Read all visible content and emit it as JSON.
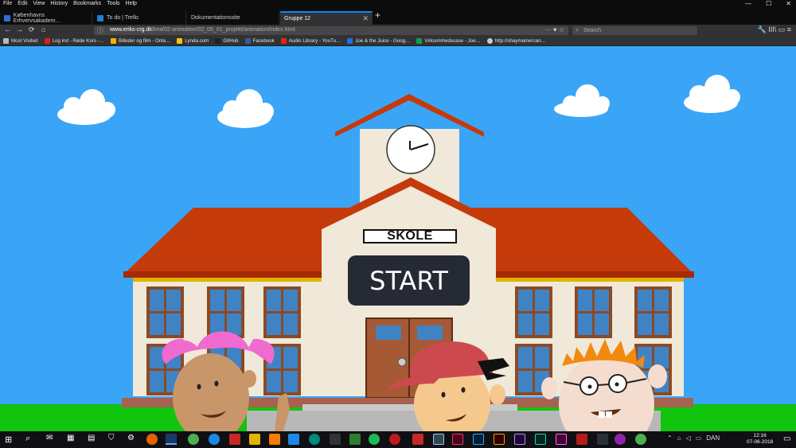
{
  "menubar": {
    "items": [
      "File",
      "Edit",
      "View",
      "History",
      "Bookmarks",
      "Tools",
      "Help"
    ],
    "minimize": "—",
    "maximize": "☐",
    "close": "✕"
  },
  "tabs": [
    {
      "label": "Københavns Erhvervsakadem…",
      "color": "#2b6fd6"
    },
    {
      "label": "To do | Trello",
      "color": "#1f7fd1"
    },
    {
      "label": "Dokumentationssite",
      "color": "#777777"
    },
    {
      "label": "Gruppe 12",
      "color": "#888888"
    }
  ],
  "new_tab": "+",
  "nav": {
    "back": "←",
    "forward": "→",
    "reload": "⟳",
    "home": "⌂",
    "url_host": "www.eriks-crg.dk",
    "url_path": "/kea/02-animation/02_05_01_projekt/animation/index.html",
    "url_actions": "··· ♥ ☆",
    "search_placeholder": "Search",
    "tools": "🔧  III\\  ▭  ≡"
  },
  "bookmarks": [
    {
      "label": "Most Visited",
      "color": "#bbbbbb"
    },
    {
      "label": "Log ind - Røde Kors -…",
      "color": "#e11d1d"
    },
    {
      "label": "Billeder og film - Onla…",
      "color": "#f2b400"
    },
    {
      "label": "Lynda.com",
      "color": "#f0c419"
    },
    {
      "label": "GitHub",
      "color": "#222222"
    },
    {
      "label": "Facebook",
      "color": "#3b5998"
    },
    {
      "label": "Audio Library - YouTu…",
      "color": "#e62117"
    },
    {
      "label": "Joe & the Juice - Goog…",
      "color": "#1a73e8"
    },
    {
      "label": "Virksomhedscase - Joe…",
      "color": "#0f9d58"
    },
    {
      "label": "http://shaymamercan…",
      "color": "#cccccc"
    }
  ],
  "page": {
    "sign_text": "SKOLE",
    "start_label": "START",
    "colors": {
      "sky": "#3aa5f6",
      "roof": "#b82b06",
      "wall": "#f0e8d8",
      "grass": "#11c40d",
      "button": "#252a34"
    }
  },
  "taskbar": {
    "start_icon": "windows-logo-icon",
    "language": "DAN",
    "time": "12:16",
    "date": "07-06-2018"
  }
}
